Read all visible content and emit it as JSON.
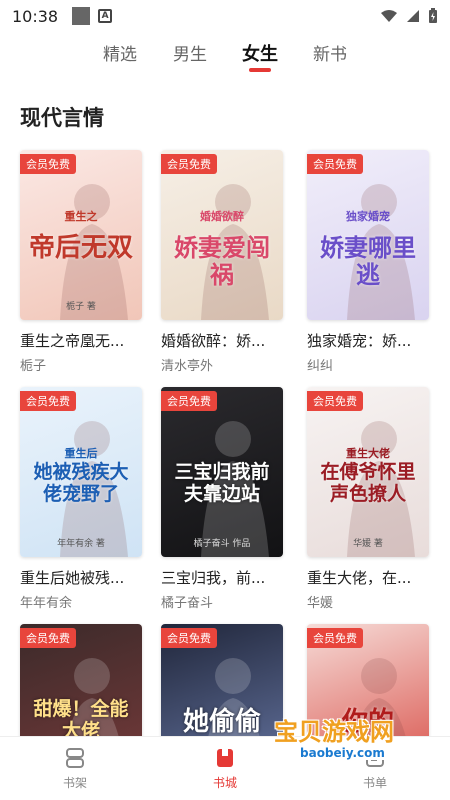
{
  "status": {
    "time": "10:38"
  },
  "tabs": [
    {
      "label": "精选",
      "active": false
    },
    {
      "label": "男生",
      "active": false
    },
    {
      "label": "女生",
      "active": true
    },
    {
      "label": "新书",
      "active": false
    }
  ],
  "section_title": "现代言情",
  "badge_label": "会员免费",
  "books": [
    {
      "title": "重生之帝凰无...",
      "author": "栀子",
      "cover_text": "帝后无双",
      "cover_sub": "重生之",
      "cover_author": "栀子 著",
      "bg": [
        "#fbe8e4",
        "#f1c6b8"
      ],
      "ink": "#c0392b"
    },
    {
      "title": "婚婚欲醉：娇...",
      "author": "清水亭外",
      "cover_text": "娇妻爱闯祸",
      "cover_sub": "婚婚欲醉",
      "cover_author": "",
      "bg": [
        "#f6efe6",
        "#e9d9c6"
      ],
      "ink": "#d9486a"
    },
    {
      "title": "独家婚宠：娇...",
      "author": "纠纠",
      "cover_text": "娇妻哪里逃",
      "cover_sub": "独家婚宠",
      "cover_author": "",
      "bg": [
        "#f1eefa",
        "#d9d3f0"
      ],
      "ink": "#6a4fc9"
    },
    {
      "title": "重生后她被残...",
      "author": "年年有余",
      "cover_text": "她被残疾大佬宠野了",
      "cover_sub": "重生后",
      "cover_author": "年年有余 著",
      "bg": [
        "#eaf3fb",
        "#cfe3f5"
      ],
      "ink": "#1d5fb4"
    },
    {
      "title": "三宝归我，前...",
      "author": "橘子奋斗",
      "cover_text": "三宝归我前夫靠边站",
      "cover_sub": "",
      "cover_author": "橘子奋斗 作品",
      "bg": [
        "#2b2a2e",
        "#121214"
      ],
      "ink": "#ffffff"
    },
    {
      "title": "重生大佬，在...",
      "author": "华媛",
      "cover_text": "在傅爷怀里声色撩人",
      "cover_sub": "重生大佬",
      "cover_author": "华媛 著",
      "bg": [
        "#f7f3f2",
        "#e8dcda"
      ],
      "ink": "#9b1c24"
    },
    {
      "title": "",
      "author": "",
      "cover_text": "甜爆！全能大佬",
      "cover_sub": "",
      "cover_author": "",
      "bg": [
        "#3b2a2a",
        "#7a3b3b"
      ],
      "ink": "#ffe08a"
    },
    {
      "title": "",
      "author": "",
      "cover_text": "她偷偷",
      "cover_sub": "",
      "cover_author": "",
      "bg": [
        "#20263a",
        "#6a7aa8"
      ],
      "ink": "#ffffff"
    },
    {
      "title": "",
      "author": "",
      "cover_text": "你的",
      "cover_sub": "",
      "cover_author": "",
      "bg": [
        "#f6dcd8",
        "#d6453d"
      ],
      "ink": "#b01c1c"
    }
  ],
  "nav": [
    {
      "label": "书架",
      "active": false,
      "icon": "bookshelf-icon"
    },
    {
      "label": "书城",
      "active": true,
      "icon": "bookstore-icon"
    },
    {
      "label": "书单",
      "active": false,
      "icon": "booklist-icon"
    }
  ],
  "watermark": {
    "title": "宝贝游戏网",
    "url": "baobeiy.com"
  },
  "colors": {
    "accent": "#e53935",
    "badge": "#e8453c"
  }
}
